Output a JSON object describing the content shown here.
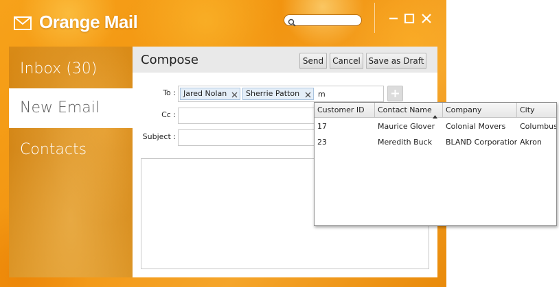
{
  "app": {
    "title": "Orange Mail"
  },
  "search": {
    "placeholder": "",
    "value": ""
  },
  "sidebar": {
    "items": [
      {
        "label": "Inbox (30)"
      },
      {
        "label": "New Email"
      },
      {
        "label": "Contacts"
      }
    ],
    "active_index": 1
  },
  "compose": {
    "title": "Compose",
    "buttons": {
      "send": "Send",
      "cancel": "Cancel",
      "save_draft": "Save as Draft"
    },
    "to_label": "To :",
    "cc_label": "Cc :",
    "subject_label": "Subject :",
    "to_tokens": [
      "Jared Nolan",
      "Sherrie Patton"
    ],
    "to_input_value": "m",
    "cc_value": "",
    "subject_value": "",
    "body_value": ""
  },
  "dropdown": {
    "columns": [
      "Customer ID",
      "Contact Name",
      "Company",
      "City"
    ],
    "sorted_column": "Contact Name",
    "sort_direction": "ascending",
    "rows": [
      {
        "customer_id": "17",
        "contact_name": "Maurice Glover",
        "company": "Colonial Movers",
        "city": "Columbus"
      },
      {
        "customer_id": "23",
        "contact_name": "Meredith Buck",
        "company": "BLAND Corporation",
        "city": "Akron"
      }
    ]
  },
  "colors": {
    "accent_orange": "#f29410",
    "sidebar_orange": "#d98a16",
    "token_bg": "#e4eef8",
    "header_gray": "#e9e9e9"
  }
}
